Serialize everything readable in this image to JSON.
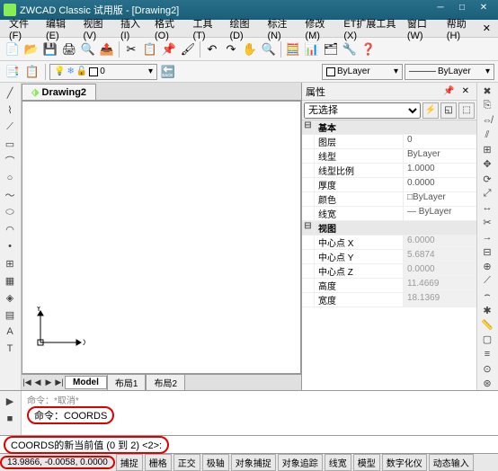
{
  "window": {
    "title": "ZWCAD Classic 试用版 - [Drawing2]"
  },
  "menus": [
    {
      "label": "文件(F)"
    },
    {
      "label": "编辑(E)"
    },
    {
      "label": "视图(V)"
    },
    {
      "label": "插入(I)"
    },
    {
      "label": "格式(O)"
    },
    {
      "label": "工具(T)"
    },
    {
      "label": "绘图(D)"
    },
    {
      "label": "标注(N)"
    },
    {
      "label": "修改(M)"
    },
    {
      "label": "ET扩展工具(X)"
    },
    {
      "label": "窗口(W)"
    },
    {
      "label": "帮助(H)"
    }
  ],
  "toolbar1": [
    {
      "name": "new-icon",
      "glyph": "📄"
    },
    {
      "name": "open-icon",
      "glyph": "📂"
    },
    {
      "name": "save-icon",
      "glyph": "💾"
    },
    {
      "name": "print-icon",
      "glyph": "🖨"
    },
    {
      "name": "preview-icon",
      "glyph": "🔍"
    },
    {
      "name": "publish-icon",
      "glyph": "📤"
    },
    {
      "name": "cut-icon",
      "glyph": "✂"
    },
    {
      "name": "copy-icon",
      "glyph": "📋"
    },
    {
      "name": "paste-icon",
      "glyph": "📌"
    },
    {
      "name": "match-icon",
      "glyph": "🖌"
    },
    {
      "name": "undo-icon",
      "glyph": "↶"
    },
    {
      "name": "redo-icon",
      "glyph": "↷"
    },
    {
      "name": "pan-icon",
      "glyph": "✋"
    },
    {
      "name": "zoom-icon",
      "glyph": "🔍"
    },
    {
      "name": "calc-icon",
      "glyph": "🧮"
    },
    {
      "name": "props-icon",
      "glyph": "📊"
    },
    {
      "name": "design-icon",
      "glyph": "🗂"
    },
    {
      "name": "tool-icon",
      "glyph": "🔧"
    },
    {
      "name": "help-icon",
      "glyph": "❓"
    }
  ],
  "layer_panel": {
    "current_layer": "0",
    "bylayer1": "ByLayer",
    "bylayer2": "ByLayer"
  },
  "ltools": [
    "line-icon",
    "polyline-icon",
    "ray-icon",
    "rect-icon",
    "arc-icon",
    "circle-icon",
    "spline-icon",
    "ellipse-icon",
    "ellipse-arc-icon",
    "point-icon",
    "block-icon",
    "hatch-icon",
    "region-icon",
    "table-icon",
    "text-icon",
    "mtext-icon"
  ],
  "rtools": [
    "erase-icon",
    "copy-icon",
    "mirror-icon",
    "offset-icon",
    "array-icon",
    "move-icon",
    "rotate-icon",
    "scale-icon",
    "stretch-icon",
    "trim-icon",
    "extend-icon",
    "break-icon",
    "join-icon",
    "chamfer-icon",
    "fillet-icon",
    "explode-icon",
    "dist-icon",
    "area-icon",
    "list-icon",
    "id-icon",
    "center-icon"
  ],
  "drawing_tab": "Drawing2",
  "layouts": [
    {
      "label": "Model",
      "active": true
    },
    {
      "label": "布局1",
      "active": false
    },
    {
      "label": "布局2",
      "active": false
    }
  ],
  "palette": {
    "title": "属性",
    "selector": "无选择",
    "groups": [
      {
        "label": "基本",
        "rows": [
          {
            "k": "图层",
            "v": "0",
            "ro": false
          },
          {
            "k": "线型",
            "v": "ByLayer",
            "ro": false
          },
          {
            "k": "线型比例",
            "v": "1.0000",
            "ro": false
          },
          {
            "k": "厚度",
            "v": "0.0000",
            "ro": false
          },
          {
            "k": "颜色",
            "v": "□ByLayer",
            "ro": false
          },
          {
            "k": "线宽",
            "v": "— ByLayer",
            "ro": false
          }
        ]
      },
      {
        "label": "视图",
        "rows": [
          {
            "k": "中心点 X",
            "v": "6.0000",
            "ro": true
          },
          {
            "k": "中心点 Y",
            "v": "5.6874",
            "ro": true
          },
          {
            "k": "中心点 Z",
            "v": "0.0000",
            "ro": true
          },
          {
            "k": "高度",
            "v": "11.4669",
            "ro": true
          },
          {
            "k": "宽度",
            "v": "18.1369",
            "ro": true
          }
        ]
      }
    ]
  },
  "command": {
    "line1": "命令：",
    "highlight": "命令：COORDS",
    "prompt": "COORDS的新当前值 (0 到 2) <2>:"
  },
  "status": {
    "coords": "13.9866, -0.0058, 0.0000",
    "buttons": [
      "捕捉",
      "栅格",
      "正交",
      "极轴",
      "对象捕捉",
      "对象追踪",
      "线宽",
      "模型",
      "数字化仪",
      "动态输入"
    ]
  }
}
